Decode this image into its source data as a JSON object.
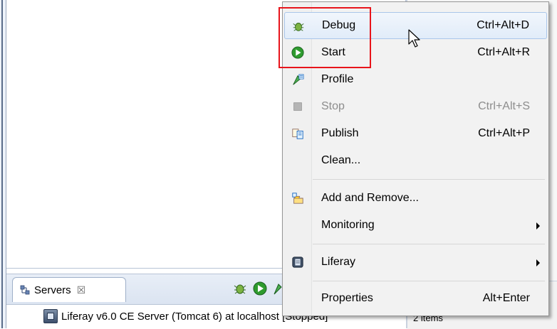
{
  "menu": {
    "items": [
      {
        "label": "Debug",
        "shortcut": "Ctrl+Alt+D",
        "icon": "debug-bug-icon",
        "state": "hover"
      },
      {
        "label": "Start",
        "shortcut": "Ctrl+Alt+R",
        "icon": "start-run-icon",
        "state": "normal"
      },
      {
        "label": "Profile",
        "shortcut": "",
        "icon": "profile-icon",
        "state": "normal"
      },
      {
        "label": "Stop",
        "shortcut": "Ctrl+Alt+S",
        "icon": "stop-icon",
        "state": "disabled"
      },
      {
        "label": "Publish",
        "shortcut": "Ctrl+Alt+P",
        "icon": "publish-icon",
        "state": "normal"
      },
      {
        "label": "Clean...",
        "shortcut": "",
        "icon": "",
        "state": "normal"
      },
      {
        "label": "Add and Remove...",
        "shortcut": "",
        "icon": "add-remove-icon",
        "state": "normal"
      },
      {
        "label": "Monitoring",
        "shortcut": "",
        "icon": "",
        "state": "submenu"
      },
      {
        "label": "Liferay",
        "shortcut": "",
        "icon": "liferay-icon",
        "state": "submenu"
      },
      {
        "label": "Properties",
        "shortcut": "Alt+Enter",
        "icon": "",
        "state": "normal"
      }
    ]
  },
  "servers_view": {
    "tab_label": "Servers",
    "tab_close": "☒",
    "server_entry": "Liferay v6.0 CE Server (Tomcat 6) at localhost  [Stopped]",
    "toolbar_icons": [
      "debug-bug-icon",
      "start-run-icon",
      "profile-icon"
    ]
  },
  "side_panel": {
    "items_count": "2 items"
  },
  "colors": {
    "highlight_box": "#e8141b",
    "hover_bg": "#e1ecf9",
    "run_green": "#2e9b2e"
  }
}
